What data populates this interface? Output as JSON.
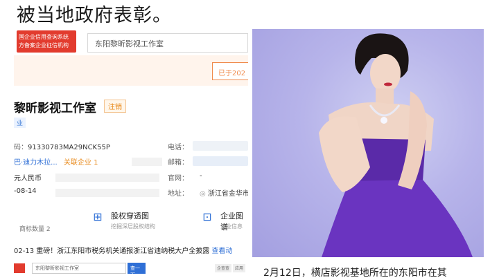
{
  "headline": "被当地政府表彰。",
  "left": {
    "promo_line1": "国企业信用查询系统",
    "promo_line2": "方备案企业征信机构",
    "search_value": "东阳黎昕影视工作室",
    "banner_button": "已于202",
    "company_name": "黎昕影视工作室",
    "status_badge": "注销",
    "tag": "业",
    "credit_code_label": "码：",
    "credit_code": "91330783MA29NCK55P",
    "legal_rep": "巴·迪力木拉...",
    "related": "关联企业 1",
    "capital": "元人民币",
    "date": "-08-14",
    "phone_label": "电话：",
    "email_label": "邮箱：",
    "website_label": "官网：",
    "website_value": "-",
    "address_label": "地址：",
    "address_value": "浙江省金华市",
    "trademark_count": "商标数量 2",
    "feature1_title": "股权穿透图",
    "feature1_sub": "挖掘深层股权结构",
    "feature2_title": "企业图谱",
    "feature2_sub": "企业信息",
    "news_date": "02-13",
    "news_text": "重磅！浙江东阳市税务机关通报浙江省迪纳税大户全披露",
    "news_more": "查看动",
    "bottom_search": "东阳黎昕影视工作室",
    "bottom_button": "查一下",
    "bottom_chip1": "企查查",
    "bottom_chip2": "应用"
  },
  "caption": "2月12日，横店影视基地所在的东阳市在其",
  "colors": {
    "promo_red": "#e23b2e",
    "link_blue": "#2f6fd6",
    "banner_orange": "#f08a4b",
    "dress_purple": "#5a2aa8"
  }
}
